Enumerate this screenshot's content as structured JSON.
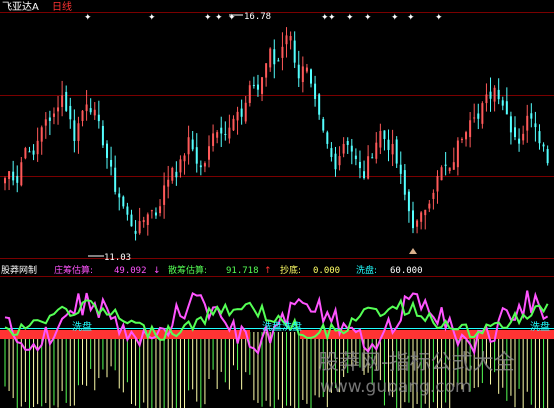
{
  "header": {
    "title": "飞亚达A",
    "period": "日线"
  },
  "colors": {
    "background": "#000000",
    "up": "#ff5a5a",
    "down": "#54ffff",
    "grid": "#7a0000",
    "title": "#ffffff",
    "period": "#ff3333",
    "annotation": "#ffffff",
    "dealer": "#ff55ff",
    "retail": "#55ff55",
    "dip": "#ffff66",
    "wash": "#ff3333",
    "washline": "#22ffff",
    "watermark": "#888888"
  },
  "main_chart": {
    "high_label": "16.78",
    "low_label": "11.03",
    "high_value": 16.78,
    "low_value": 11.03,
    "signal_marker_count": 12
  },
  "indicator": {
    "name": "股莽网制",
    "dealer_label": "庄筹估算:",
    "dealer_value": "49.092",
    "dealer_arrow": "↓",
    "retail_label": "散筹估算:",
    "retail_value": "91.718",
    "retail_arrow": "↑",
    "dip_label": "抄底:",
    "dip_value": "0.000",
    "wash_label": "洗盘:",
    "wash_value": "60.000",
    "wash_tag_1": "洗盘",
    "wash_tag_2": "洗盘洗盘",
    "wash_tag_3": "洗盘"
  },
  "watermark": {
    "line1": "股莽网-指标公式大全",
    "line2": "www.gupang.com"
  },
  "chart_data": {
    "type": "candlestick",
    "title": "飞亚达A 日线",
    "y_high": 16.78,
    "y_low": 11.03,
    "close_path": [
      12.9,
      13.1,
      12.8,
      13.4,
      13.8,
      13.3,
      14.0,
      14.4,
      14.1,
      14.7,
      14.9,
      14.4,
      13.9,
      14.3,
      14.8,
      14.6,
      14.2,
      13.8,
      13.2,
      12.7,
      12.4,
      12.0,
      11.8,
      11.6,
      11.9,
      12.2,
      12.0,
      12.4,
      12.8,
      13.2,
      13.0,
      13.5,
      13.8,
      13.4,
      13.1,
      13.4,
      13.9,
      14.2,
      13.9,
      14.3,
      14.6,
      14.3,
      14.8,
      15.2,
      15.0,
      15.6,
      15.9,
      15.5,
      16.1,
      16.5,
      15.9,
      15.3,
      15.6,
      15.0,
      14.5,
      14.0,
      13.6,
      13.2,
      13.5,
      13.9,
      13.6,
      13.2,
      12.9,
      13.3,
      13.7,
      14.0,
      13.8,
      13.6,
      13.2,
      12.6,
      12.1,
      11.7,
      11.9,
      12.3,
      12.6,
      12.9,
      13.2,
      13.0,
      13.5,
      13.9,
      14.2,
      14.6,
      14.3,
      14.7,
      14.9,
      15.1,
      14.8,
      14.4,
      14.0,
      13.8,
      14.1,
      14.5,
      14.2,
      13.7,
      13.4
    ],
    "indicator_series": [
      {
        "name": "庄筹估算",
        "last": 49.092
      },
      {
        "name": "散筹估算",
        "last": 91.718
      },
      {
        "name": "抄底",
        "last": 0.0
      },
      {
        "name": "洗盘",
        "last": 60.0
      }
    ]
  }
}
